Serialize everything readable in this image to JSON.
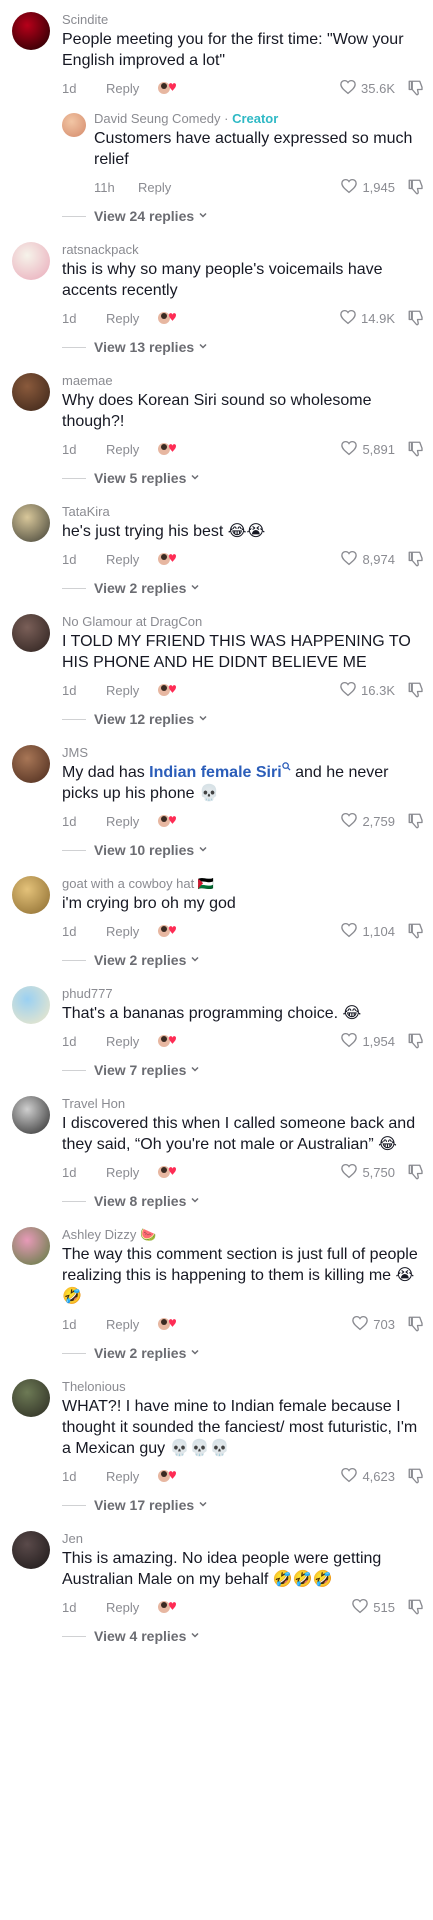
{
  "comments": [
    {
      "author": "Scindite",
      "text": "People meeting you for the first time: \"Wow your English improved a lot\"",
      "time": "1d",
      "reply_label": "Reply",
      "likes": "35.6K",
      "avatar_colors": [
        "#b7001a",
        "#1a0000"
      ],
      "sub_reply": {
        "author": "David Seung Comedy",
        "author_badge": "Creator",
        "separator": "·",
        "text": "Customers have actually expressed so much relief",
        "time": "11h",
        "reply_label": "Reply",
        "likes": "1,945",
        "avatar_colors": [
          "#f2c6a5",
          "#d48a6b"
        ]
      },
      "view_replies": "View 24 replies"
    },
    {
      "author": "ratsnackpack",
      "text": "this is why so many people's voicemails have accents recently",
      "time": "1d",
      "reply_label": "Reply",
      "likes": "14.9K",
      "avatar_colors": [
        "#f6f3ea",
        "#e9a9b9"
      ],
      "view_replies": "View 13 replies"
    },
    {
      "author": "maemae",
      "text": "Why does Korean Siri sound so wholesome though?!",
      "time": "1d",
      "reply_label": "Reply",
      "likes": "5,891",
      "avatar_colors": [
        "#8a5a3c",
        "#3a2418"
      ],
      "view_replies": "View 5 replies"
    },
    {
      "author": "TataKira",
      "text": "he's just trying his best 😂😭",
      "time": "1d",
      "reply_label": "Reply",
      "likes": "8,974",
      "avatar_colors": [
        "#d8c79a",
        "#3f3f35"
      ],
      "view_replies": "View 2 replies"
    },
    {
      "author": "No Glamour at DragCon",
      "text": "I TOLD MY FRIEND THIS WAS HAPPENING TO HIS PHONE AND HE DIDNT BELIEVE ME",
      "time": "1d",
      "reply_label": "Reply",
      "likes": "16.3K",
      "avatar_colors": [
        "#7a5f58",
        "#2b201d"
      ],
      "view_replies": "View 12 replies"
    },
    {
      "author": "JMS",
      "text_before": "My dad has ",
      "text_link": "Indian female Siri",
      "text_after": " and he never picks up his phone 💀",
      "time": "1d",
      "reply_label": "Reply",
      "likes": "2,759",
      "avatar_colors": [
        "#a87656",
        "#4a2a1c"
      ],
      "view_replies": "View 10 replies"
    },
    {
      "author": "goat with a cowboy hat 🇵🇸",
      "text": "i'm crying bro oh my god",
      "time": "1d",
      "reply_label": "Reply",
      "likes": "1,104",
      "avatar_colors": [
        "#e4c27a",
        "#8a6a2e"
      ],
      "view_replies": "View 2 replies"
    },
    {
      "author": "phud777",
      "text": "That's a bananas programming choice. 😂",
      "time": "1d",
      "reply_label": "Reply",
      "likes": "1,954",
      "avatar_colors": [
        "#9ad0f2",
        "#f2e9c8"
      ],
      "view_replies": "View 7 replies"
    },
    {
      "author": "Travel Hon",
      "text": "I discovered this when I called someone back and they said, “Oh you're not male or Australian” 😂",
      "time": "1d",
      "reply_label": "Reply",
      "likes": "5,750",
      "avatar_colors": [
        "#cfcfcf",
        "#2a2a2a"
      ],
      "view_replies": "View 8 replies"
    },
    {
      "author": "Ashley Dizzy 🍉",
      "text": "The way this comment section is just full of people realizing this is happening to them is killing me 😭🤣",
      "time": "1d",
      "reply_label": "Reply",
      "likes": "703",
      "avatar_colors": [
        "#e79ab8",
        "#5a7b3c"
      ],
      "view_replies": "View 2 replies"
    },
    {
      "author": "Thelonious",
      "text": "WHAT?! I have mine to Indian female because I thought it sounded the fanciest/ most futuristic, I'm a Mexican guy 💀💀💀",
      "time": "1d",
      "reply_label": "Reply",
      "likes": "4,623",
      "avatar_colors": [
        "#6d7a55",
        "#2b2b22"
      ],
      "view_replies": "View 17 replies"
    },
    {
      "author": "Jen",
      "text": "This is amazing. No idea people were getting Australian Male on my behalf 🤣🤣🤣",
      "time": "1d",
      "reply_label": "Reply",
      "likes": "515",
      "avatar_colors": [
        "#5a4a4a",
        "#1c1818"
      ],
      "view_replies": "View 4 replies"
    }
  ],
  "icons": {
    "heart": "heart-outline-icon",
    "dislike": "thumbs-down-icon",
    "creator_react": "creator-heart-react-icon",
    "chevron": "chevron-down-icon",
    "search": "search-icon"
  },
  "colors": {
    "author": "#8a8b91",
    "text": "#161823",
    "creator_badge": "#2fb9c5",
    "search_link": "#2b5db9"
  }
}
